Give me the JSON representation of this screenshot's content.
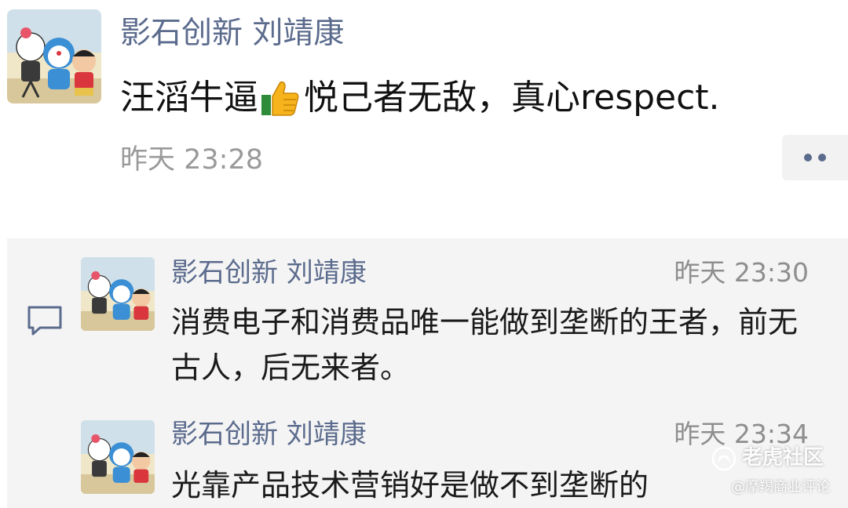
{
  "post": {
    "author": "影石创新 刘靖康",
    "text_before_emoji": "汪滔牛逼",
    "emoji": "thumbs-up-emoji",
    "text_after_emoji": "悦己者无敌，真心respect.",
    "time": "昨天 23:28",
    "more_icon": "more-dots-icon"
  },
  "comments_icon": "comment-bubble-icon",
  "comments": [
    {
      "author": "影石创新 刘靖康",
      "time": "昨天 23:30",
      "text": "消费电子和消费品唯一能做到垄断的王者，前无古人，后无来者。"
    },
    {
      "author": "影石创新 刘靖康",
      "time": "昨天 23:34",
      "text": "光靠产品技术营销好是做不到垄断的"
    }
  ],
  "watermark": {
    "brand": "老虎社区",
    "source": "@摩羯商业评论"
  },
  "colors": {
    "author_link": "#5b6b8d",
    "timestamp": "#9a9a9a",
    "comment_bg": "#f4f4f4",
    "text": "#111111"
  }
}
